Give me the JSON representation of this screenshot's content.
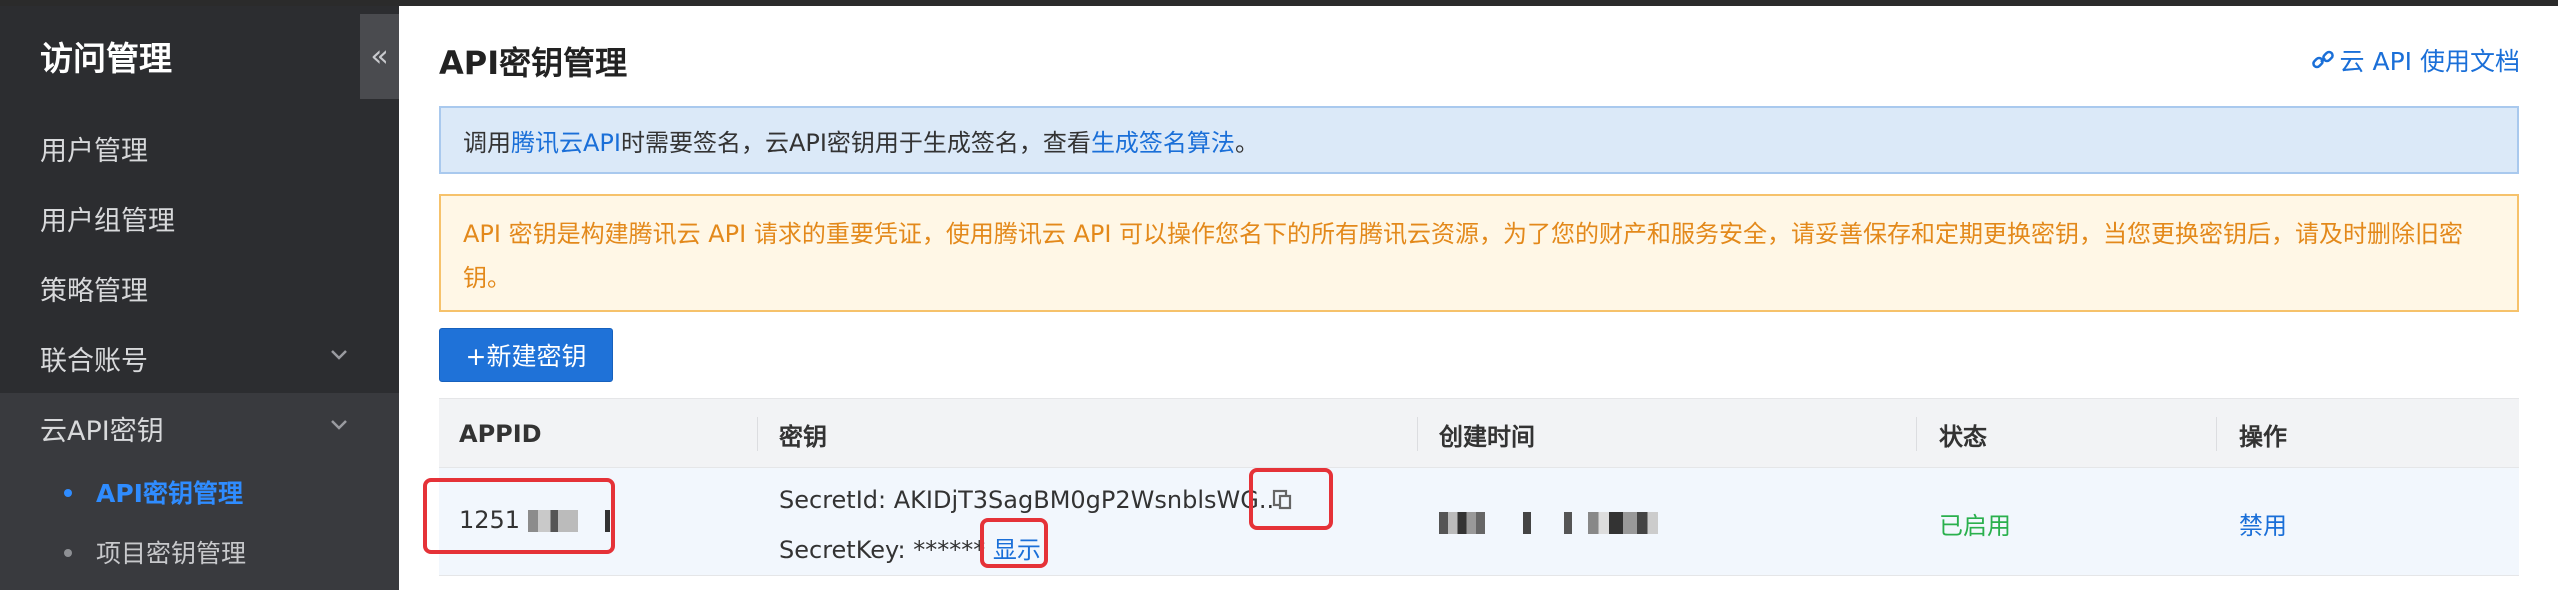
{
  "sidebar": {
    "title": "访问管理",
    "collapse_icon": "«",
    "items": [
      {
        "label": "用户管理"
      },
      {
        "label": "用户组管理"
      },
      {
        "label": "策略管理"
      },
      {
        "label": "联合账号"
      },
      {
        "label": "云API密钥"
      }
    ],
    "sub_items": [
      {
        "label": "API密钥管理",
        "active": true
      },
      {
        "label": "项目密钥管理",
        "active": false
      }
    ]
  },
  "main": {
    "title": "API密钥管理",
    "doc_link": "云 API 使用文档",
    "info": {
      "prefix": "调用",
      "link1": "腾讯云API",
      "middle": "时需要签名，云API密钥用于生成签名，查看",
      "link2": "生成签名算法",
      "suffix": "。"
    },
    "warning": "API 密钥是构建腾讯云 API 请求的重要凭证，使用腾讯云 API 可以操作您名下的所有腾讯云资源，为了您的财产和服务安全，请妥善保存和定期更换密钥，当您更换密钥后，请及时删除旧密钥。",
    "new_button": "+新建密钥",
    "table": {
      "headers": [
        "APPID",
        "密钥",
        "创建时间",
        "状态",
        "操作"
      ],
      "rows": [
        {
          "appid": "1251",
          "secret_id": "SecretId: AKIDjT3SagBM0gP2WsnblsWG..",
          "secret_key": "SecretKey: ******",
          "show": "显示",
          "status": "已启用",
          "action": "禁用"
        }
      ]
    }
  },
  "colors": {
    "sidebar_bg": "#2c2d30",
    "accent": "#1f72d8",
    "status_on": "#2ab04d",
    "highlight": "#e53238"
  }
}
